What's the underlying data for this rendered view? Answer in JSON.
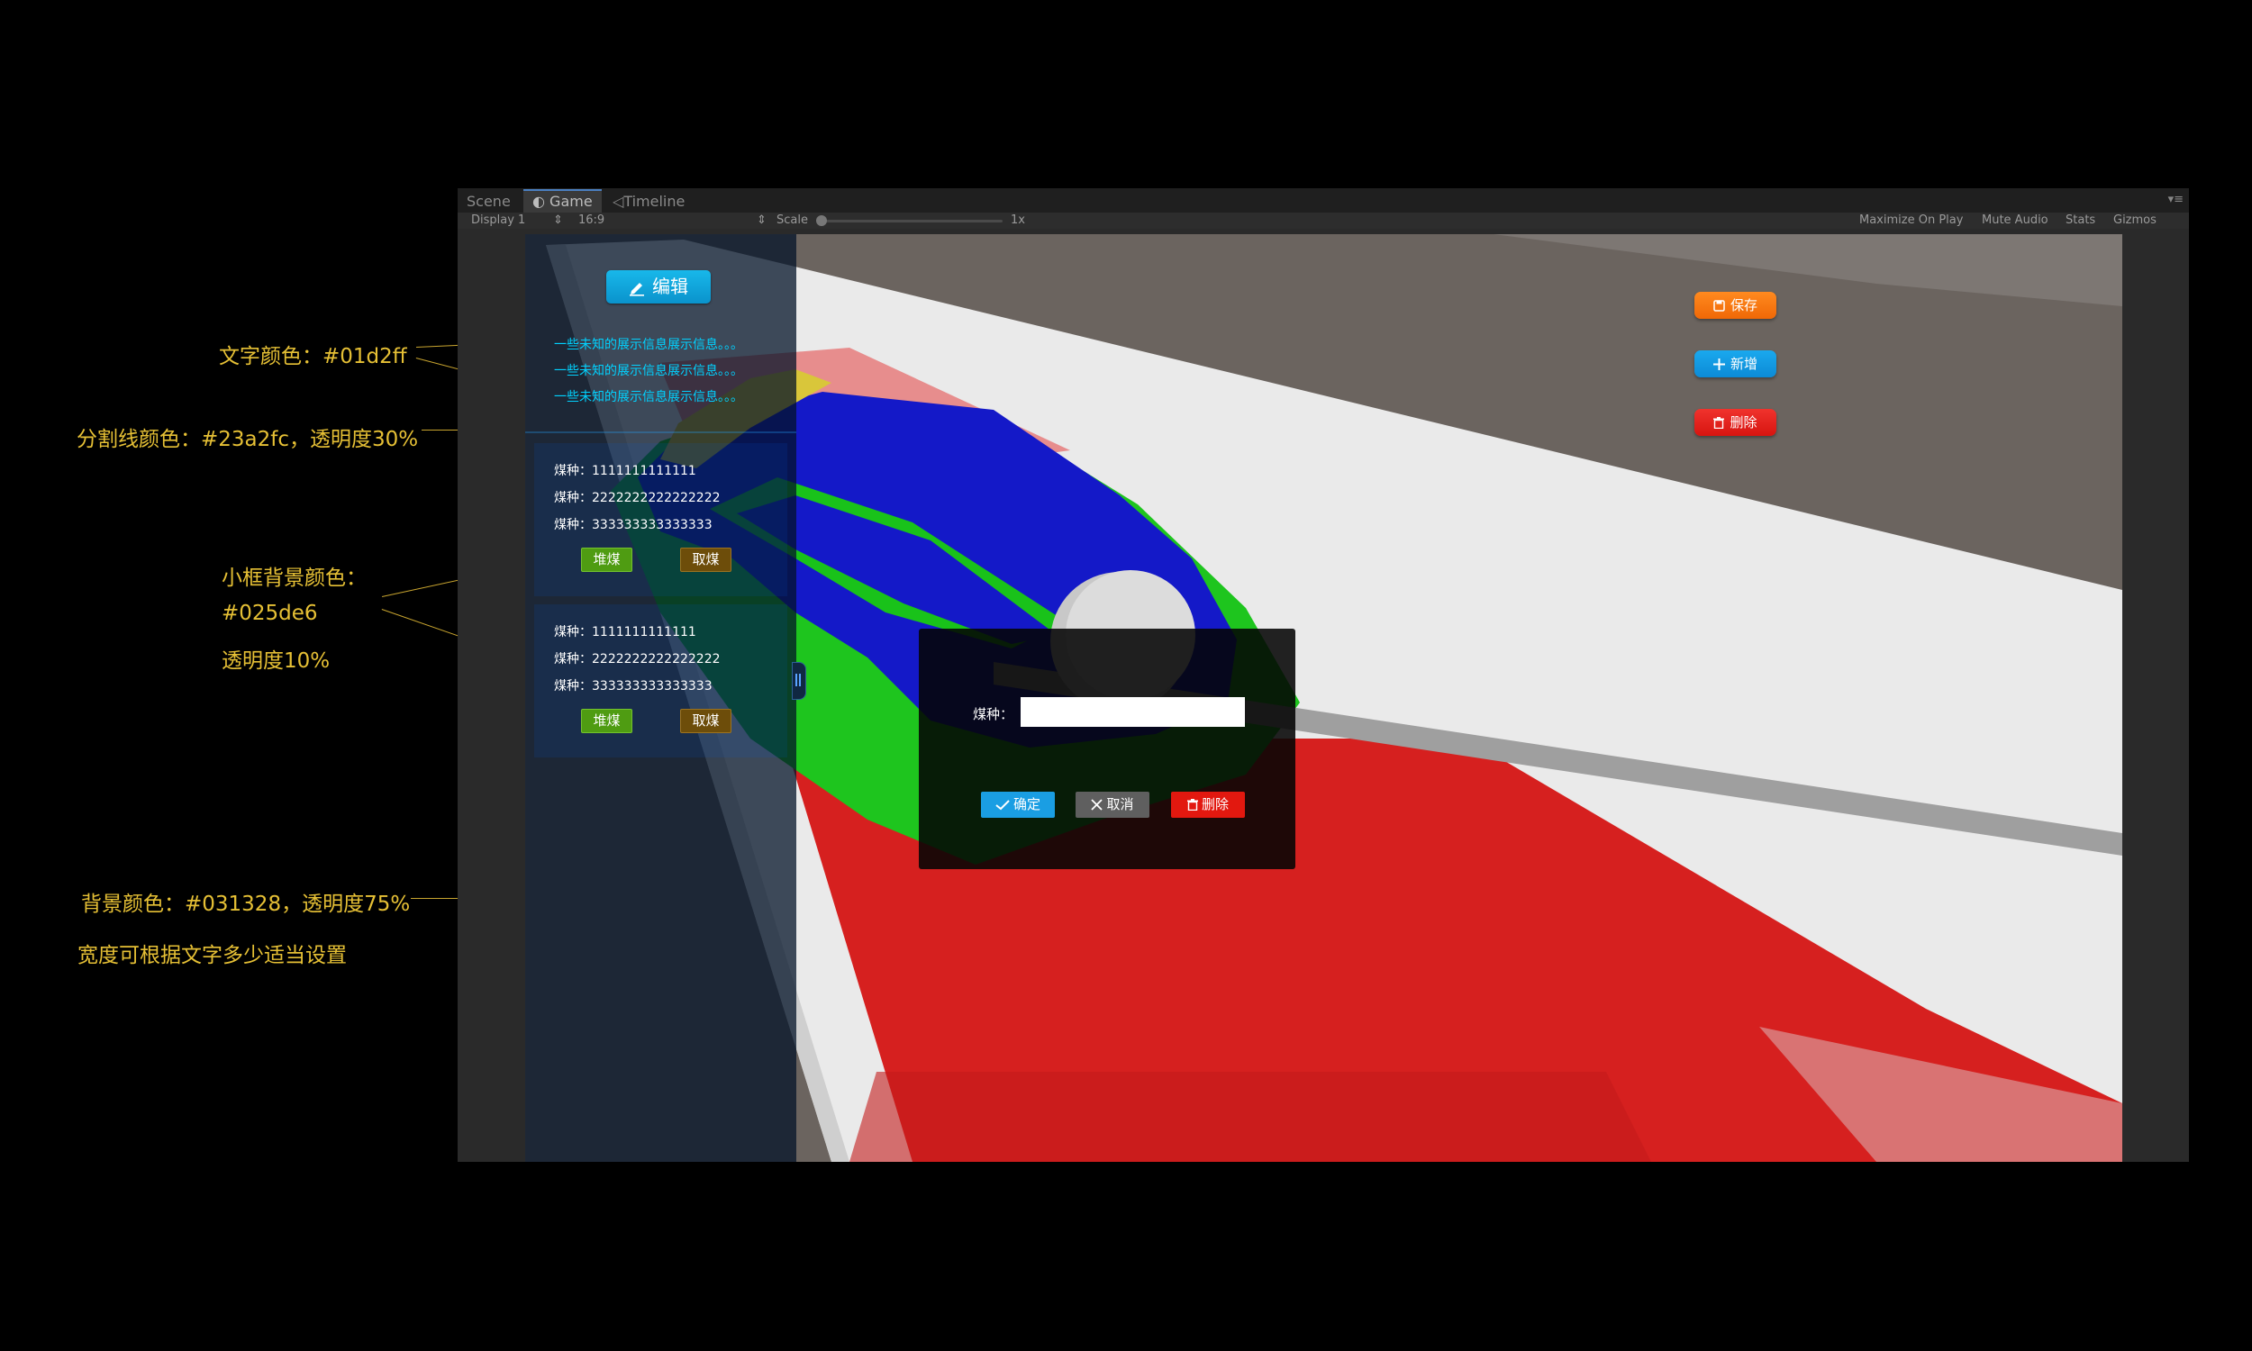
{
  "annotations": {
    "text_color": "文字颜色：#01d2ff",
    "divider_color": "分割线颜色：#23a2fc，透明度30%",
    "card_bg_title": "小框背景颜色：",
    "card_bg_color": "#025de6",
    "card_bg_opacity": "透明度10%",
    "panel_bg": "背景颜色：#031328，透明度75%",
    "panel_width_note": "宽度可根据文字多少适当设置"
  },
  "editor": {
    "tabs": [
      "Scene",
      "Game",
      "Timeline"
    ],
    "display": "Display 1",
    "aspect": "16:9",
    "scale_label": "Scale",
    "scale_value": "1x",
    "toolbar_right": [
      "Maximize On Play",
      "Mute Audio",
      "Stats",
      "Gizmos"
    ]
  },
  "panel": {
    "edit_label": "编辑",
    "info_lines": [
      "一些未知的展示信息展示信息。。。",
      "一些未知的展示信息展示信息。。。",
      "一些未知的展示信息展示信息。。。"
    ],
    "cards": [
      {
        "rows": [
          "煤种：1111111111111",
          "煤种：2222222222222222",
          "煤种：333333333333333"
        ],
        "pile_label": "堆煤",
        "take_label": "取煤"
      },
      {
        "rows": [
          "煤种：1111111111111",
          "煤种：2222222222222222",
          "煤种：333333333333333"
        ],
        "pile_label": "堆煤",
        "take_label": "取煤"
      }
    ]
  },
  "actions": {
    "save_label": "保存",
    "add_label": "新增",
    "delete_label": "删除"
  },
  "dialog": {
    "field_label": "煤种：",
    "field_value": "",
    "ok_label": "确定",
    "cancel_label": "取消",
    "delete_label": "删除"
  },
  "colors": {
    "text": "#01d2ff",
    "divider": "#23a2fc",
    "card_bg": "#025de6",
    "panel_bg": "#031328"
  }
}
